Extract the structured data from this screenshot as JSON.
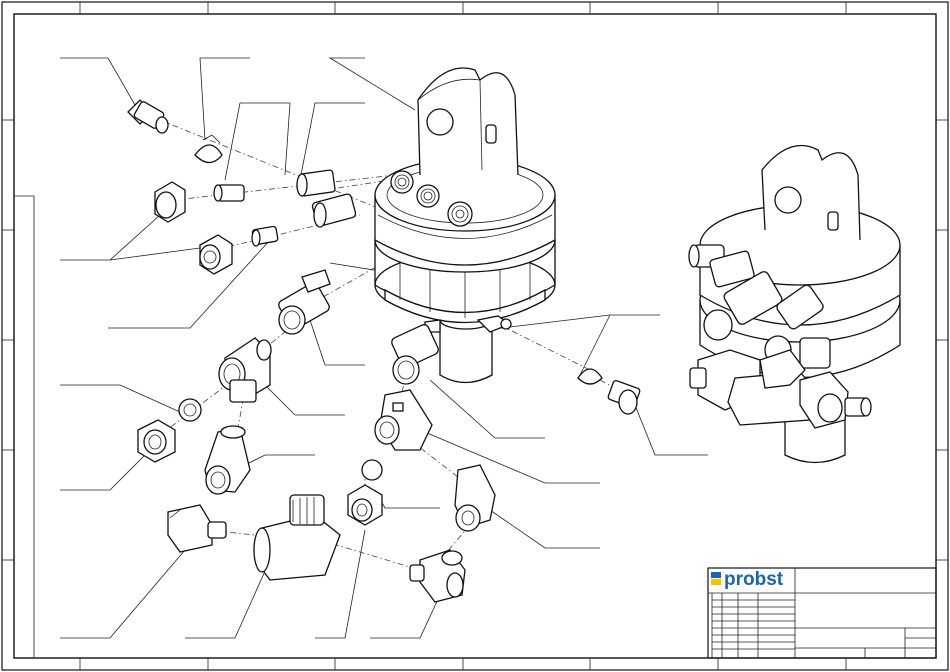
{
  "title_block": {
    "logo_text": "probst",
    "logo_colors": {
      "text": "#1a64b4",
      "bar_top": "#1a64b4",
      "bar_bottom": "#f2c500"
    }
  }
}
